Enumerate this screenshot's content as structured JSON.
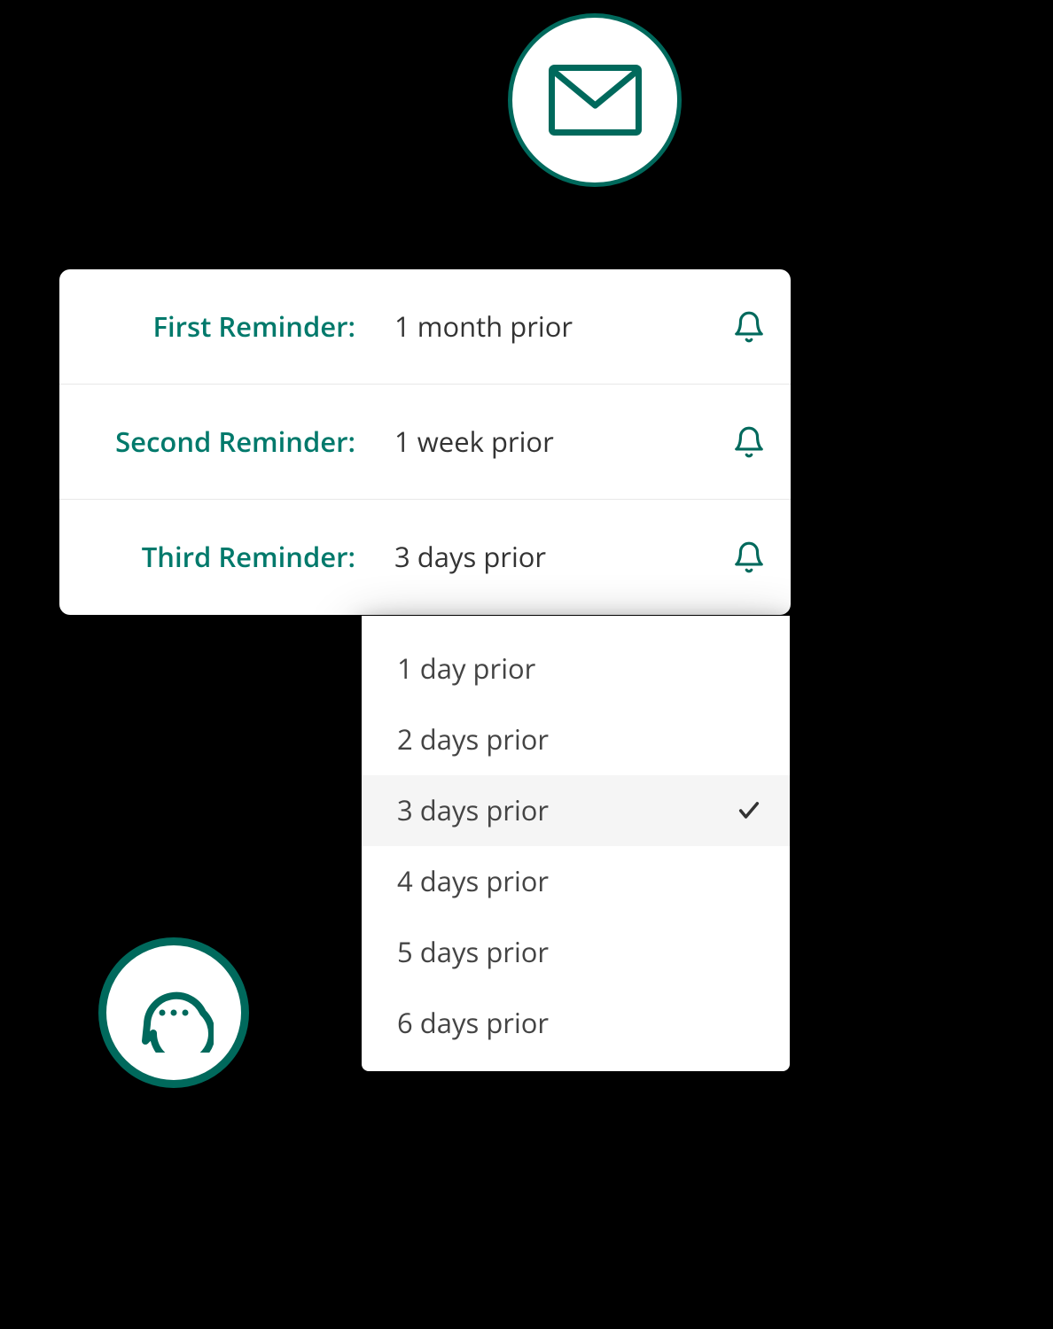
{
  "reminders": [
    {
      "label": "First Reminder:",
      "value": "1 month prior"
    },
    {
      "label": "Second Reminder:",
      "value": "1 week prior"
    },
    {
      "label": "Third Reminder:",
      "value": "3 days prior"
    }
  ],
  "dropdown": {
    "options": [
      "1 day prior",
      "2 days prior",
      "3 days prior",
      "4 days prior",
      "5 days prior",
      "6 days prior"
    ],
    "selected_index": 2
  },
  "colors": {
    "accent": "#00695c",
    "text": "#333333"
  }
}
